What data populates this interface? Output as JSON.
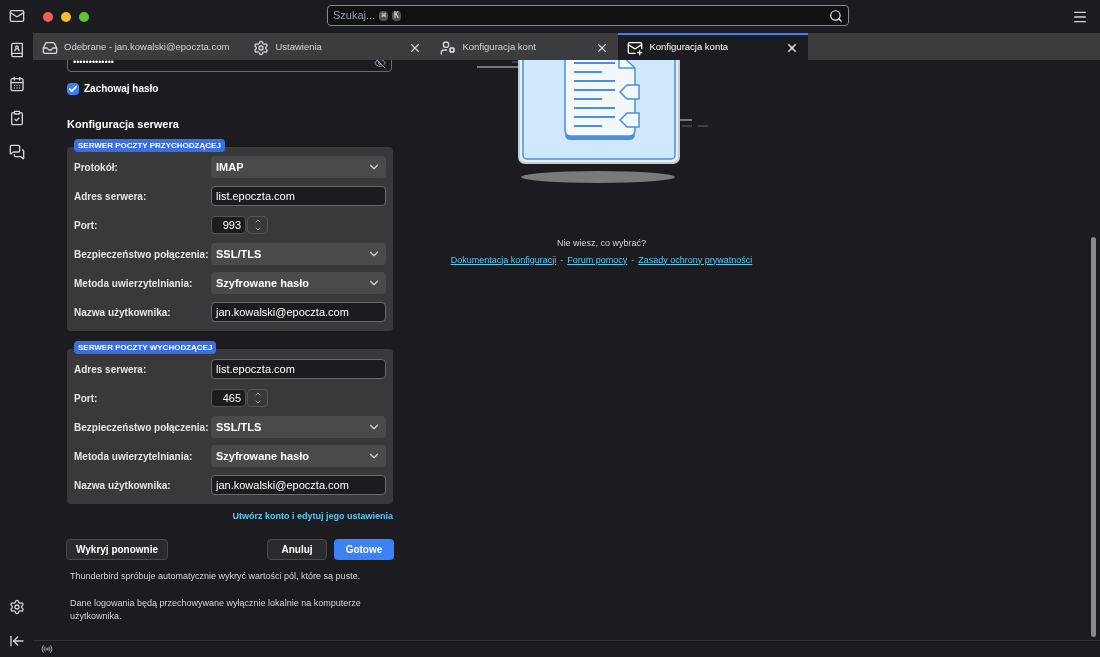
{
  "search": {
    "placeholder": "Szukaj...",
    "keys": [
      "⌘",
      "K"
    ]
  },
  "tabs": [
    {
      "kind": "inbox",
      "label": "Odebrane - jan.kowalski@epoczta.com",
      "selected": false,
      "closable": false
    },
    {
      "kind": "settings",
      "label": "Ustawienia",
      "selected": false,
      "closable": true
    },
    {
      "kind": "accounts",
      "label": "Konfiguracja kont",
      "selected": false,
      "closable": true
    },
    {
      "kind": "mail-setup",
      "label": "Konfiguracja konta",
      "selected": true,
      "closable": true
    }
  ],
  "password": {
    "value": "•••••••••••••"
  },
  "remember_password": {
    "label": "Zachowaj hasło",
    "checked": true
  },
  "server_config": {
    "title": "Konfiguracja serwera",
    "groups": [
      {
        "badge": "SERWER POCZTY PRZYCHODZĄCEJ",
        "rows": [
          {
            "kind": "select",
            "label": "Protokół:",
            "value": "IMAP"
          },
          {
            "kind": "text",
            "label": "Adres serwera:",
            "value": "list.epoczta.com"
          },
          {
            "kind": "number",
            "label": "Port:",
            "value": "993"
          },
          {
            "kind": "select",
            "label": "Bezpieczeństwo połączenia:",
            "value": "SSL/TLS"
          },
          {
            "kind": "select",
            "label": "Metoda uwierzytelniania:",
            "value": "Szyfrowane hasło"
          },
          {
            "kind": "text",
            "label": "Nazwa użytkownika:",
            "value": "jan.kowalski@epoczta.com"
          }
        ]
      },
      {
        "badge": "SERWER POCZTY WYCHODZĄCEJ",
        "rows": [
          {
            "kind": "text",
            "label": "Adres serwera:",
            "value": "list.epoczta.com"
          },
          {
            "kind": "number",
            "label": "Port:",
            "value": "465"
          },
          {
            "kind": "select",
            "label": "Bezpieczeństwo połączenia:",
            "value": "SSL/TLS"
          },
          {
            "kind": "select",
            "label": "Metoda uwierzytelniania:",
            "value": "Szyfrowane hasło"
          },
          {
            "kind": "text",
            "label": "Nazwa użytkownika:",
            "value": "jan.kowalski@epoczta.com"
          }
        ]
      }
    ]
  },
  "advanced_link": "Utwórz konto i edytuj jego ustawienia",
  "buttons": {
    "retest": "Wykryj ponownie",
    "cancel": "Anuluj",
    "done": "Gotowe"
  },
  "notes": [
    "Thunderbird spróbuje automatycznie wykryć wartości pól, które są puste.",
    "Dane logowania będą przechowywane wyłącznie lokalnie na komputerze użytkownika."
  ],
  "help": {
    "question": "Nie wiesz, co wybrać?",
    "links": [
      "Dokumentacja konfiguracji",
      "Forum pomocy",
      "Zasady ochrony prywatności"
    ],
    "separator": "-"
  }
}
